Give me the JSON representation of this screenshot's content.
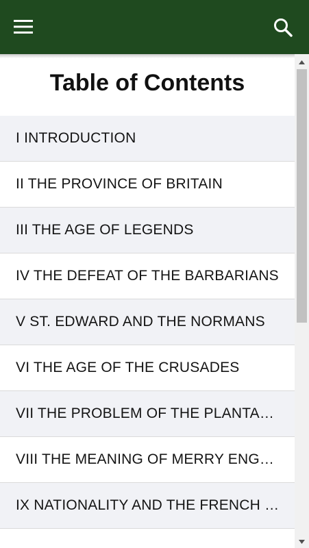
{
  "appbar": {
    "menu_icon": "hamburger-menu-icon",
    "search_icon": "search-icon",
    "background_color": "#1f4a1f"
  },
  "page": {
    "title": "Table of Contents"
  },
  "toc": {
    "items": [
      {
        "label": "I INTRODUCTION"
      },
      {
        "label": "II THE PROVINCE OF BRITAIN"
      },
      {
        "label": "III THE AGE OF LEGENDS"
      },
      {
        "label": "IV THE DEFEAT OF THE BARBARIANS"
      },
      {
        "label": "V ST. EDWARD AND THE NORMANS"
      },
      {
        "label": "VI THE AGE OF THE CRUSADES"
      },
      {
        "label": "VII THE PROBLEM OF THE PLANTAGENETS"
      },
      {
        "label": "VIII THE MEANING OF MERRY ENGLAND"
      },
      {
        "label": "IX NATIONALITY AND THE FRENCH WARS"
      }
    ]
  }
}
